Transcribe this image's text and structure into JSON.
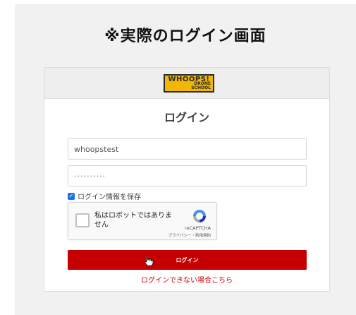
{
  "caption": "※実際のログイン画面",
  "logo": {
    "main": "WHOOPS!",
    "sub_line1": "DRONE",
    "sub_line2": "SCHOOL"
  },
  "login": {
    "title": "ログイン",
    "username_value": "whoopstest",
    "password_value": "··········",
    "remember_label": "ログイン情報を保存",
    "remember_checked": true,
    "submit_label": "ログイン",
    "forgot_link": "ログインできない場合こちら"
  },
  "recaptcha": {
    "label": "私はロボットではありません",
    "brand": "reCAPTCHA",
    "terms": "プライバシー・利用規約"
  },
  "colors": {
    "accent": "#c60000",
    "logo_yellow": "#f2b705",
    "checkbox_blue": "#1a73e8"
  },
  "icons": [
    "recaptcha-logo-icon",
    "hand-cursor-icon",
    "checkbox-checked-icon"
  ]
}
